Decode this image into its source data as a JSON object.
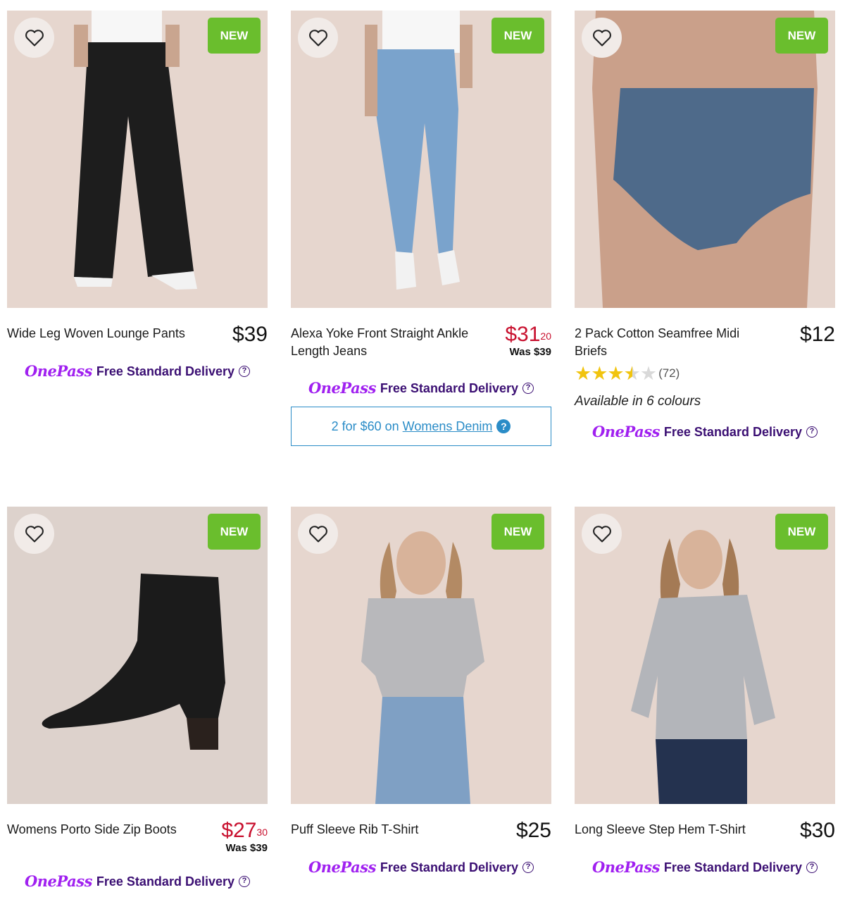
{
  "colors": {
    "new_badge": "#6abe2d",
    "sale_price": "#c8102e",
    "onepass": "#a020f0",
    "delivery_text": "#3b0f73",
    "promo": "#2a8cc7"
  },
  "products": [
    {
      "title": "Wide Leg Woven Lounge Pants",
      "price": "$39",
      "badge": "NEW",
      "onepass": "OnePass",
      "delivery": "Free Standard Delivery",
      "image": "black-wide-leg-pants"
    },
    {
      "title": "Alexa Yoke Front Straight Ankle Length Jeans",
      "price_dollars": "$31",
      "price_cents": "20",
      "was": "Was $39",
      "badge": "NEW",
      "onepass": "OnePass",
      "delivery": "Free Standard Delivery",
      "promo": {
        "prefix": "2 for $60 on",
        "link": "Womens Denim"
      },
      "image": "light-blue-jeans"
    },
    {
      "title": "2 Pack Cotton Seamfree Midi Briefs",
      "price": "$12",
      "badge": "NEW",
      "rating": 4.5,
      "rating_count": "(72)",
      "colours": "Available in 6 colours",
      "onepass": "OnePass",
      "delivery": "Free Standard Delivery",
      "image": "blue-briefs"
    },
    {
      "title": "Womens Porto Side Zip Boots",
      "price_dollars": "$27",
      "price_cents": "30",
      "was": "Was $39",
      "onepass": "OnePass",
      "delivery": "Free Standard Delivery",
      "image": "black-ankle-boot"
    },
    {
      "title": "Puff Sleeve Rib T-Shirt",
      "price": "$25",
      "badge": "NEW",
      "onepass": "OnePass",
      "delivery": "Free Standard Delivery",
      "image": "grey-puff-sleeve-tee"
    },
    {
      "title": "Long Sleeve Step Hem T-Shirt",
      "price": "$30",
      "badge": "NEW",
      "onepass": "OnePass",
      "delivery": "Free Standard Delivery",
      "image": "grey-long-sleeve-tee"
    }
  ]
}
